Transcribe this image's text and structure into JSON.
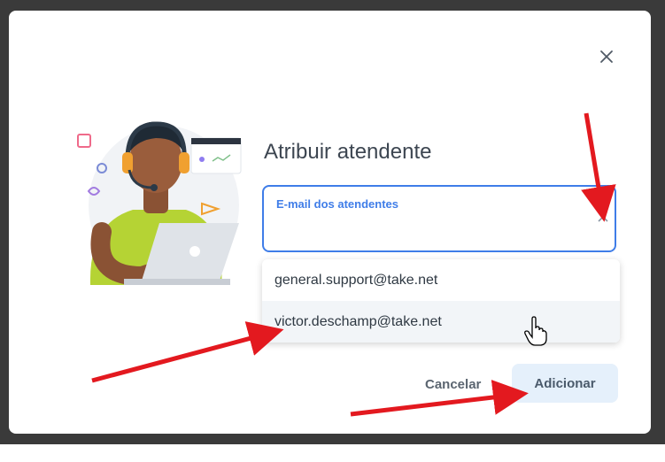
{
  "dialog": {
    "title": "Atribuir atendente",
    "close_icon": "close-icon",
    "illustration": "support-agent-illustration"
  },
  "field": {
    "label": "E-mail dos atendentes",
    "value": "",
    "chevron_icon": "chevron-up-icon"
  },
  "dropdown": {
    "options": [
      {
        "label": "general.support@take.net"
      },
      {
        "label": "victor.deschamp@take.net"
      }
    ],
    "hovered_index": 1
  },
  "buttons": {
    "cancel": "Cancelar",
    "add": "Adicionar"
  },
  "annotations": {
    "arrow_color": "#e3191f",
    "cursor": "hand-pointer-icon"
  },
  "colors": {
    "accent": "#3f7de8",
    "title": "#3d4651",
    "add_button_bg": "#e5f0fb",
    "backdrop": "#3a3a3a"
  }
}
